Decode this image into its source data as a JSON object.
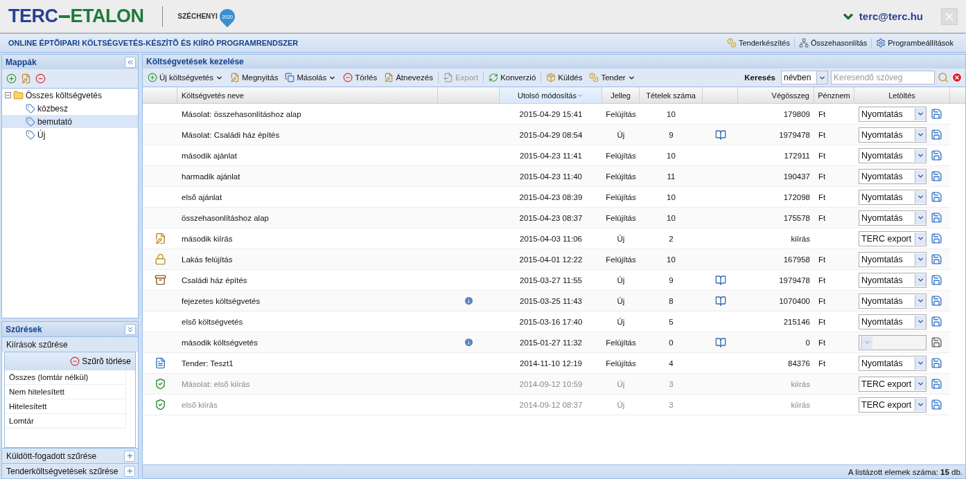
{
  "header": {
    "logo": {
      "first": "TERC",
      "second": "ETALON"
    },
    "partner": {
      "name": "SZÉCHENYI",
      "year": "2020"
    },
    "user": "terc@terc.hu"
  },
  "app_bar": {
    "title": "ONLINE ÉPTÕIPARI KÖLTSÉGVETÉS-KÉSZÍTÕ ÉS KIÍRÓ PROGRAMRENDSZER",
    "links": [
      "Tenderkészítés",
      "Összehasonlítás",
      "Programbeállítások"
    ]
  },
  "folders": {
    "title": "Mappák",
    "tree": [
      {
        "label": "Összes költségvetés",
        "expanded": true,
        "selected": false,
        "children": [
          {
            "label": "közbesz",
            "selected": false
          },
          {
            "label": "bemutató",
            "selected": true
          },
          {
            "label": "Új",
            "selected": false
          }
        ]
      }
    ]
  },
  "filters": {
    "title": "Szűrések",
    "sections": [
      {
        "label": "Kiírások szűrése",
        "expanded": true,
        "clear": "Szűrõ törlése",
        "items": [
          "Összes (lomtár nélkül)",
          "Nem hitelesített",
          "Hitelesített",
          "Lomtár"
        ]
      },
      {
        "label": "Küldött-fogadott szűrése",
        "expanded": false
      },
      {
        "label": "Tenderköltségvetések szűrése",
        "expanded": false
      }
    ]
  },
  "main": {
    "title": "Költségvetések kezelése",
    "toolbar": [
      {
        "kind": "button",
        "label": "Új költségvetés",
        "dropdown": true,
        "disabled": false
      },
      {
        "kind": "button",
        "label": "Megnyitás",
        "dropdown": false,
        "disabled": false
      },
      {
        "kind": "button",
        "label": "Másolás",
        "dropdown": true,
        "disabled": false
      },
      {
        "kind": "button",
        "label": "Törlés",
        "dropdown": false,
        "disabled": false
      },
      {
        "kind": "button",
        "label": "Átnevezés",
        "dropdown": false,
        "disabled": false
      },
      {
        "kind": "separator"
      },
      {
        "kind": "button",
        "label": "Export",
        "dropdown": false,
        "disabled": true
      },
      {
        "kind": "separator"
      },
      {
        "kind": "button",
        "label": "Konverzió",
        "dropdown": false,
        "disabled": false
      },
      {
        "kind": "separator"
      },
      {
        "kind": "button",
        "label": "Küldés",
        "dropdown": false,
        "disabled": false
      },
      {
        "kind": "button",
        "label": "Tender",
        "dropdown": true,
        "disabled": false
      }
    ],
    "search": {
      "label": "Keresés",
      "scope": "névben",
      "placeholder": "Keresendõ szöveg"
    },
    "columns": [
      {
        "label": "Költségvetés neve",
        "sorted": false
      },
      {
        "label": "Utolsó módosítás",
        "sorted": true
      },
      {
        "label": "Jelleg",
        "sorted": false
      },
      {
        "label": "Tételek száma",
        "sorted": false
      },
      {
        "label": "Végösszeg",
        "sorted": false
      },
      {
        "label": "Pénznem",
        "sorted": false
      },
      {
        "label": "Letöltés",
        "sorted": false
      }
    ],
    "rows": [
      {
        "kind": "plain",
        "name": "Másolat: összehasonlításhoz alap",
        "info": false,
        "modified": "2015-04-29 15:41",
        "type": "Felújítás",
        "items": "10",
        "book": false,
        "total": "179809",
        "currency": "Ft",
        "download": {
          "value": "Nyomtatás",
          "disabled": false
        },
        "muted": false
      },
      {
        "kind": "plain",
        "name": "Másolat: Családi ház építés",
        "info": false,
        "modified": "2015-04-29 08:54",
        "type": "Új",
        "items": "9",
        "book": true,
        "total": "1979478",
        "currency": "Ft",
        "download": {
          "value": "Nyomtatás",
          "disabled": false
        },
        "muted": false
      },
      {
        "kind": "plain",
        "name": "második ajánlat",
        "info": false,
        "modified": "2015-04-23 11:41",
        "type": "Felújítás",
        "items": "10",
        "book": false,
        "total": "172911",
        "currency": "Ft",
        "download": {
          "value": "Nyomtatás",
          "disabled": false
        },
        "muted": false
      },
      {
        "kind": "plain",
        "name": "harmadik ajánlat",
        "info": false,
        "modified": "2015-04-23 11:40",
        "type": "Felújítás",
        "items": "11",
        "book": false,
        "total": "190437",
        "currency": "Ft",
        "download": {
          "value": "Nyomtatás",
          "disabled": false
        },
        "muted": false
      },
      {
        "kind": "plain",
        "name": "elsõ ajánlat",
        "info": false,
        "modified": "2015-04-23 08:39",
        "type": "Felújítás",
        "items": "10",
        "book": false,
        "total": "172098",
        "currency": "Ft",
        "download": {
          "value": "Nyomtatás",
          "disabled": false
        },
        "muted": false
      },
      {
        "kind": "plain",
        "name": "összehasonlításhoz alap",
        "info": false,
        "modified": "2015-04-23 08:37",
        "type": "Felújítás",
        "items": "10",
        "book": false,
        "total": "175578",
        "currency": "Ft",
        "download": {
          "value": "Nyomtatás",
          "disabled": false
        },
        "muted": false
      },
      {
        "kind": "draft",
        "name": "második kiírás",
        "info": false,
        "modified": "2015-04-03 11:06",
        "type": "Új",
        "items": "2",
        "book": false,
        "total": "kiírás",
        "download": {
          "value": "TERC export",
          "disabled": false
        },
        "muted": false
      },
      {
        "kind": "locked",
        "name": "Lakás felújítás",
        "info": false,
        "modified": "2015-04-01 12:22",
        "type": "Felújítás",
        "items": "10",
        "book": false,
        "total": "167958",
        "currency": "Ft",
        "download": {
          "value": "Nyomtatás",
          "disabled": false
        },
        "muted": false
      },
      {
        "kind": "archived",
        "name": "Családi ház építés",
        "info": false,
        "modified": "2015-03-27 11:55",
        "type": "Új",
        "items": "9",
        "book": true,
        "total": "1979478",
        "currency": "Ft",
        "download": {
          "value": "Nyomtatás",
          "disabled": false
        },
        "muted": false
      },
      {
        "kind": "plain",
        "name": "fejezetes költségvetés",
        "info": true,
        "modified": "2015-03-25 11:43",
        "type": "Új",
        "items": "8",
        "book": true,
        "total": "1070400",
        "currency": "Ft",
        "download": {
          "value": "Nyomtatás",
          "disabled": false
        },
        "muted": false
      },
      {
        "kind": "plain",
        "name": "elsõ költségvetés",
        "info": false,
        "modified": "2015-03-16 17:40",
        "type": "Új",
        "items": "5",
        "book": false,
        "total": "215146",
        "currency": "Ft",
        "download": {
          "value": "Nyomtatás",
          "disabled": false
        },
        "muted": false
      },
      {
        "kind": "plain",
        "name": "második költségvetés",
        "info": true,
        "modified": "2015-01-27 11:32",
        "type": "Felújítás",
        "items": "0",
        "book": true,
        "total": "0",
        "currency": "Ft",
        "download": {
          "disabled": true
        },
        "muted": false
      },
      {
        "kind": "tender",
        "name": "Tender: Teszt1",
        "info": false,
        "modified": "2014-11-10 12:19",
        "type": "Felújítás",
        "items": "4",
        "book": false,
        "total": "84376",
        "currency": "Ft",
        "download": {
          "value": "Nyomtatás",
          "disabled": false
        },
        "muted": false
      },
      {
        "kind": "certified",
        "name": "Másolat: elsõ kiírás",
        "info": false,
        "modified": "2014-09-12 10:59",
        "type": "Új",
        "items": "3",
        "book": false,
        "total": "kiírás",
        "download": {
          "value": "TERC export",
          "disabled": false
        },
        "muted": true
      },
      {
        "kind": "certified",
        "name": "elsõ kiírás",
        "info": false,
        "modified": "2014-09-12 08:37",
        "type": "Új",
        "items": "3",
        "book": false,
        "total": "kiírás",
        "download": {
          "value": "TERC export",
          "disabled": false
        },
        "muted": true
      }
    ],
    "status": "A listázott elemek száma: **15** db."
  }
}
